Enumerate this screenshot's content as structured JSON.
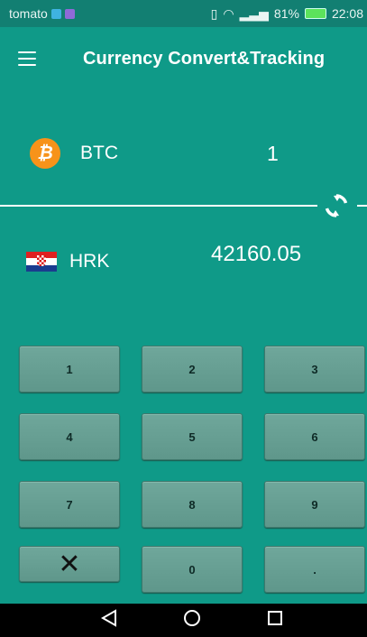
{
  "status_bar": {
    "carrier": "tomato",
    "signal_text": "81%",
    "time": "22:08"
  },
  "app_bar": {
    "title": "Currency Convert&Tracking",
    "menu_icon": "hamburger-menu-icon"
  },
  "converter": {
    "from": {
      "code": "BTC",
      "icon": "bitcoin-icon",
      "amount": "1",
      "icon_color": "#f7931a"
    },
    "to": {
      "code": "HRK",
      "icon": "croatia-flag-icon",
      "amount": "42160.05"
    },
    "swap_icon": "swap-arrows-icon"
  },
  "keypad": {
    "keys": [
      "1",
      "2",
      "3",
      "4",
      "5",
      "6",
      "7",
      "8",
      "9",
      "✕",
      "0",
      "."
    ]
  },
  "nav_bar": {
    "back": "back-triangle-icon",
    "home": "home-circle-icon",
    "recents": "recents-square-icon"
  },
  "colors": {
    "background": "#0f9a88",
    "status_bar": "#127f72",
    "key": "#6fa79b"
  }
}
